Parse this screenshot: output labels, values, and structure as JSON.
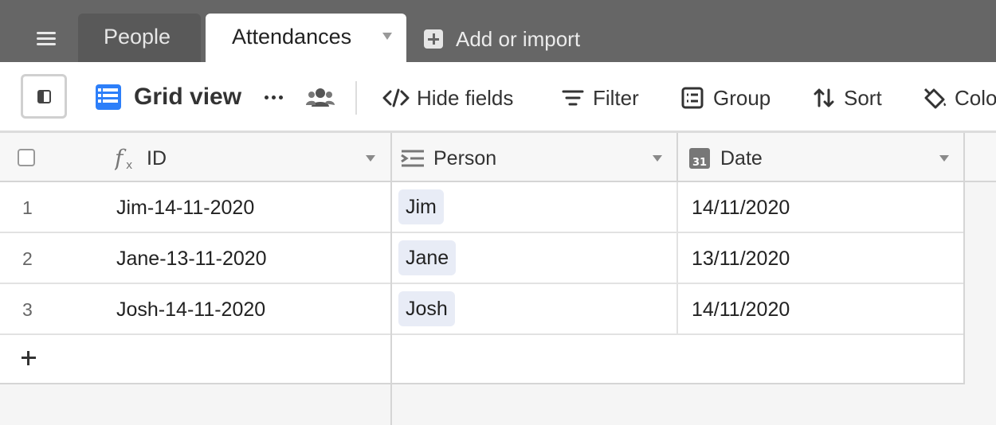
{
  "tabs": {
    "inactive_label": "People",
    "active_label": "Attendances",
    "add_label": "Add or import"
  },
  "toolbar": {
    "view_name": "Grid view",
    "hide_fields": "Hide fields",
    "filter": "Filter",
    "group": "Group",
    "sort": "Sort",
    "color": "Colo"
  },
  "table": {
    "columns": [
      {
        "name": "ID",
        "icon": "formula-icon"
      },
      {
        "name": "Person",
        "icon": "link-record-icon"
      },
      {
        "name": "Date",
        "icon": "calendar-icon"
      }
    ],
    "rows": [
      {
        "num": "1",
        "id": "Jim-14-11-2020",
        "person": "Jim",
        "date": "14/11/2020"
      },
      {
        "num": "2",
        "id": "Jane-13-11-2020",
        "person": "Jane",
        "date": "13/11/2020"
      },
      {
        "num": "3",
        "id": "Josh-14-11-2020",
        "person": "Josh",
        "date": "14/11/2020"
      }
    ]
  },
  "colors": {
    "topbar": "#666666",
    "accent_blue": "#2d7ff9",
    "chip_bg": "#e8ecf6"
  }
}
